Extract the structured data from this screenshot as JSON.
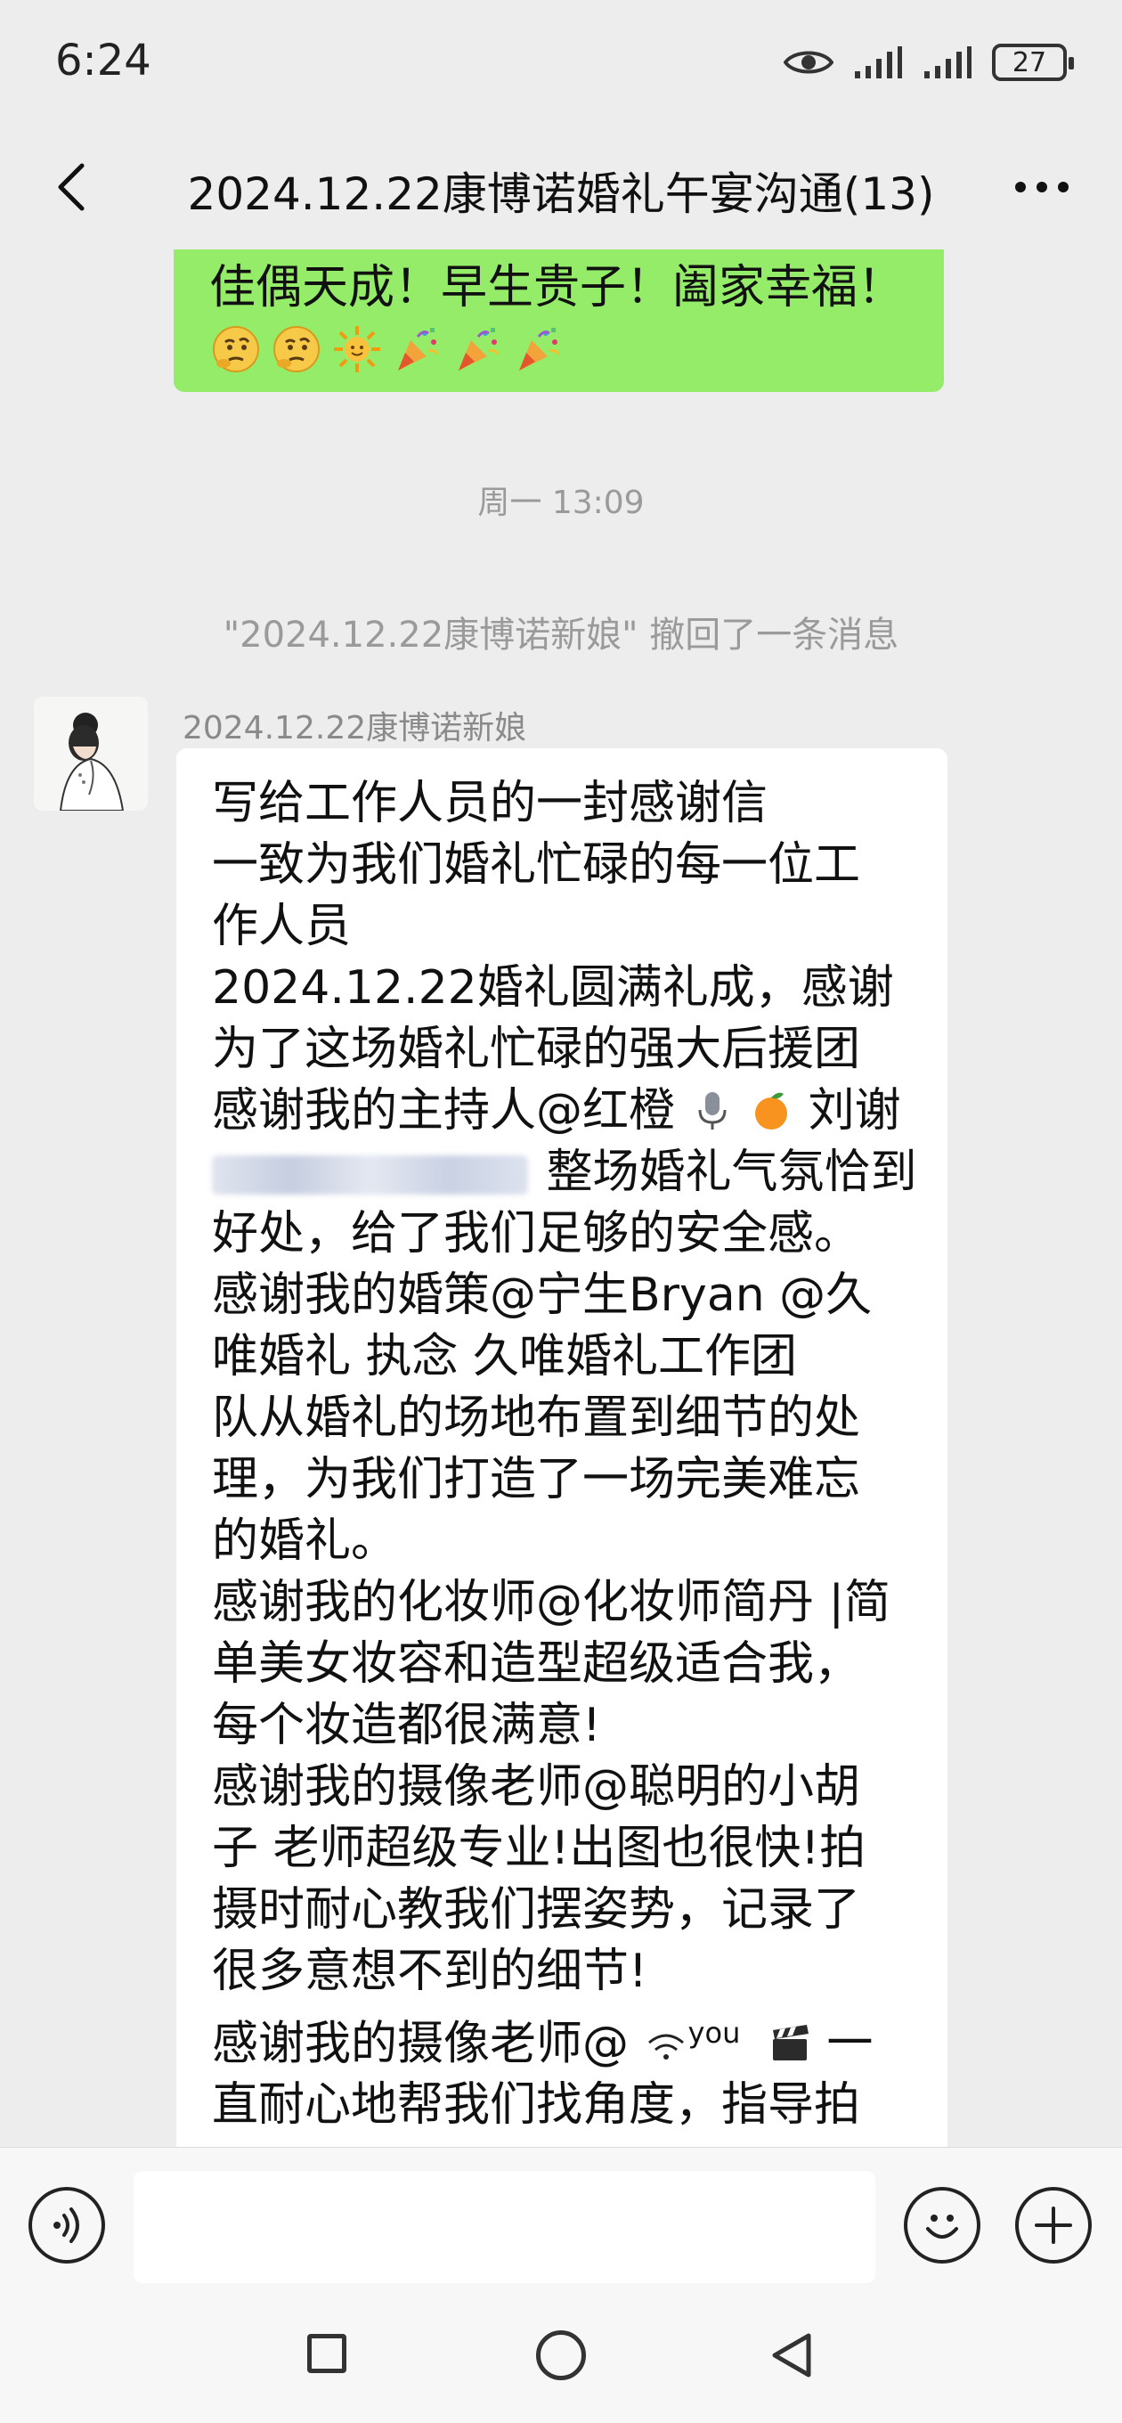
{
  "status_bar": {
    "time": "6:24",
    "battery": "27"
  },
  "header": {
    "title": "2024.12.22康博诺婚礼午宴沟通(13)"
  },
  "chat": {
    "prev_message": {
      "text": "佳偶天成！早生贵子！阖家幸福！",
      "emojis": [
        "thinking-face-emoji",
        "thinking-face-emoji",
        "sun-emoji",
        "party-popper-emoji",
        "party-popper-emoji",
        "party-popper-emoji"
      ]
    },
    "time_label": "周一 13:09",
    "recall_note": "\"2024.12.22康博诺新娘\" 撤回了一条消息",
    "message": {
      "sender": "2024.12.22康博诺新娘",
      "lines": [
        "写给工作人员的一封感谢信",
        "一致为我们婚礼忙碌的每一位工",
        "作人员",
        "2024.12.22婚礼圆满礼成，感谢",
        "为了这场婚礼忙碌的强大后援团",
        "感谢我的主持人@红橙",
        "刘谢",
        "整场婚礼气氛恰到",
        "好处，给了我们足够的安全感。",
        "感谢我的婚策@宁生Bryan @久",
        "唯婚礼  执念  久唯婚礼工作团",
        "队从婚礼的场地布置到细节的处",
        "理，为我们打造了一场完美难忘",
        "的婚礼。",
        "感谢我的化妆师@化妆师简丹 |简",
        "单美女妆容和造型超级适合我，",
        "每个妆造都很满意!",
        "感谢我的摄像老师@聪明的小胡",
        "子 老师超级专业!出图也很快!拍",
        "摄时耐心教我们摆姿势，记录了",
        "很多意想不到的细节!",
        "感谢我的摄像老师@",
        "you",
        "一",
        "直耐心地帮我们找角度，指导拍"
      ]
    }
  },
  "input_bar": {
    "placeholder": ""
  }
}
